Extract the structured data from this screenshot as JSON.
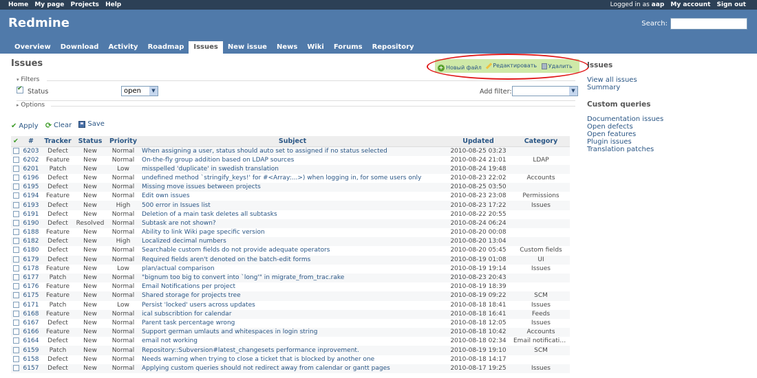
{
  "top_menu": {
    "left": [
      "Home",
      "My page",
      "Projects",
      "Help"
    ],
    "logged_in_prefix": "Logged in as",
    "user": "aap",
    "right": [
      "My account",
      "Sign out"
    ]
  },
  "header": {
    "title": "Redmine",
    "search_label": "Search:",
    "search_value": ""
  },
  "main_menu": {
    "tabs": [
      {
        "label": "Overview"
      },
      {
        "label": "Download"
      },
      {
        "label": "Activity"
      },
      {
        "label": "Roadmap"
      },
      {
        "label": "Issues",
        "selected": true
      },
      {
        "label": "New issue"
      },
      {
        "label": "News"
      },
      {
        "label": "Wiki"
      },
      {
        "label": "Forums"
      },
      {
        "label": "Repository"
      }
    ]
  },
  "page": {
    "title": "Issues",
    "actions": {
      "new_file": "Новый файл",
      "edit": "Редактировать",
      "delete": "Удалить"
    },
    "annotation_color": "#e01818"
  },
  "filters": {
    "legend": "Filters",
    "status_label": "Status",
    "status_value": "open",
    "add_filter_label": "Add filter:",
    "add_filter_value": "",
    "options_legend": "Options"
  },
  "query_buttons": {
    "apply": "Apply",
    "clear": "Clear",
    "save": "Save"
  },
  "table": {
    "columns": [
      "#",
      "Tracker",
      "Status",
      "Priority",
      "Subject",
      "Updated",
      "Category"
    ],
    "rows": [
      {
        "id": "6203",
        "tracker": "Defect",
        "status": "New",
        "priority": "Normal",
        "subject": "When assigning a user, status should auto set to assigned if no status selected",
        "updated": "2010-08-25 03:23",
        "category": ""
      },
      {
        "id": "6202",
        "tracker": "Feature",
        "status": "New",
        "priority": "Normal",
        "subject": "On-the-fly group addition based on LDAP sources",
        "updated": "2010-08-24 21:01",
        "category": "LDAP"
      },
      {
        "id": "6201",
        "tracker": "Patch",
        "status": "New",
        "priority": "Low",
        "subject": "misspelled 'duplicate' in swedish translation",
        "updated": "2010-08-24 19:48",
        "category": ""
      },
      {
        "id": "6196",
        "tracker": "Defect",
        "status": "New",
        "priority": "Normal",
        "subject": "undefined method `stringify_keys!' for #<Array:...>) when logging in, for some users only",
        "updated": "2010-08-23 22:02",
        "category": "Accounts"
      },
      {
        "id": "6195",
        "tracker": "Defect",
        "status": "New",
        "priority": "Normal",
        "subject": "Missing move issues between projects",
        "updated": "2010-08-25 03:50",
        "category": ""
      },
      {
        "id": "6194",
        "tracker": "Feature",
        "status": "New",
        "priority": "Normal",
        "subject": "Edit own issues",
        "updated": "2010-08-23 23:08",
        "category": "Permissions"
      },
      {
        "id": "6193",
        "tracker": "Defect",
        "status": "New",
        "priority": "High",
        "subject": "500 error in Issues list",
        "updated": "2010-08-23 17:22",
        "category": "Issues"
      },
      {
        "id": "6191",
        "tracker": "Defect",
        "status": "New",
        "priority": "Normal",
        "subject": "Deletion of a main task deletes all subtasks",
        "updated": "2010-08-22 20:55",
        "category": ""
      },
      {
        "id": "6190",
        "tracker": "Defect",
        "status": "Resolved",
        "priority": "Normal",
        "subject": "Subtask are not shown?",
        "updated": "2010-08-24 06:24",
        "category": ""
      },
      {
        "id": "6188",
        "tracker": "Feature",
        "status": "New",
        "priority": "Normal",
        "subject": "Ability to link Wiki page specific version",
        "updated": "2010-08-20 00:08",
        "category": ""
      },
      {
        "id": "6182",
        "tracker": "Defect",
        "status": "New",
        "priority": "High",
        "subject": "Localized decimal numbers",
        "updated": "2010-08-20 13:04",
        "category": ""
      },
      {
        "id": "6180",
        "tracker": "Defect",
        "status": "New",
        "priority": "Normal",
        "subject": "Searchable custom fields do not provide adequate operators",
        "updated": "2010-08-20 05:45",
        "category": "Custom fields"
      },
      {
        "id": "6179",
        "tracker": "Defect",
        "status": "New",
        "priority": "Normal",
        "subject": "Required fields aren't denoted on the batch-edit forms",
        "updated": "2010-08-19 01:08",
        "category": "UI"
      },
      {
        "id": "6178",
        "tracker": "Feature",
        "status": "New",
        "priority": "Low",
        "subject": "plan/actual comparison",
        "updated": "2010-08-19 19:14",
        "category": "Issues"
      },
      {
        "id": "6177",
        "tracker": "Patch",
        "status": "New",
        "priority": "Normal",
        "subject": "\"bignum too big to convert into `long'\" in migrate_from_trac.rake",
        "updated": "2010-08-23 20:43",
        "category": ""
      },
      {
        "id": "6176",
        "tracker": "Feature",
        "status": "New",
        "priority": "Normal",
        "subject": "Email Notifications per project",
        "updated": "2010-08-19 18:39",
        "category": ""
      },
      {
        "id": "6175",
        "tracker": "Feature",
        "status": "New",
        "priority": "Normal",
        "subject": "Shared storage for projects tree",
        "updated": "2010-08-19 09:22",
        "category": "SCM"
      },
      {
        "id": "6171",
        "tracker": "Patch",
        "status": "New",
        "priority": "Low",
        "subject": "Persist 'locked' users across updates",
        "updated": "2010-08-18 18:41",
        "category": "Issues"
      },
      {
        "id": "6168",
        "tracker": "Feature",
        "status": "New",
        "priority": "Normal",
        "subject": "ical subscribtion for calendar",
        "updated": "2010-08-18 16:41",
        "category": "Feeds"
      },
      {
        "id": "6167",
        "tracker": "Defect",
        "status": "New",
        "priority": "Normal",
        "subject": "Parent task percentage wrong",
        "updated": "2010-08-18 12:05",
        "category": "Issues"
      },
      {
        "id": "6166",
        "tracker": "Feature",
        "status": "New",
        "priority": "Normal",
        "subject": "Support german umlauts and whitespaces in login string",
        "updated": "2010-08-18 10:42",
        "category": "Accounts"
      },
      {
        "id": "6164",
        "tracker": "Defect",
        "status": "New",
        "priority": "Normal",
        "subject": "email not working",
        "updated": "2010-08-18 02:34",
        "category": "Email notifications"
      },
      {
        "id": "6159",
        "tracker": "Patch",
        "status": "New",
        "priority": "Normal",
        "subject": "Repository::Subversion#latest_changesets performance inprovement.",
        "updated": "2010-08-19 19:10",
        "category": "SCM"
      },
      {
        "id": "6158",
        "tracker": "Defect",
        "status": "New",
        "priority": "Normal",
        "subject": "Needs warning when trying to close a ticket that is blocked by another one",
        "updated": "2010-08-18 14:17",
        "category": ""
      },
      {
        "id": "6157",
        "tracker": "Defect",
        "status": "New",
        "priority": "Normal",
        "subject": "Applying custom queries should not redirect away from calendar or gantt pages",
        "updated": "2010-08-17 19:25",
        "category": "Issues"
      }
    ]
  },
  "sidebar": {
    "issues_heading": "Issues",
    "issues_links": [
      "View all issues",
      "Summary"
    ],
    "queries_heading": "Custom queries",
    "queries_links": [
      "Documentation issues",
      "Open defects",
      "Open features",
      "Plugin issues",
      "Translation patches"
    ]
  }
}
